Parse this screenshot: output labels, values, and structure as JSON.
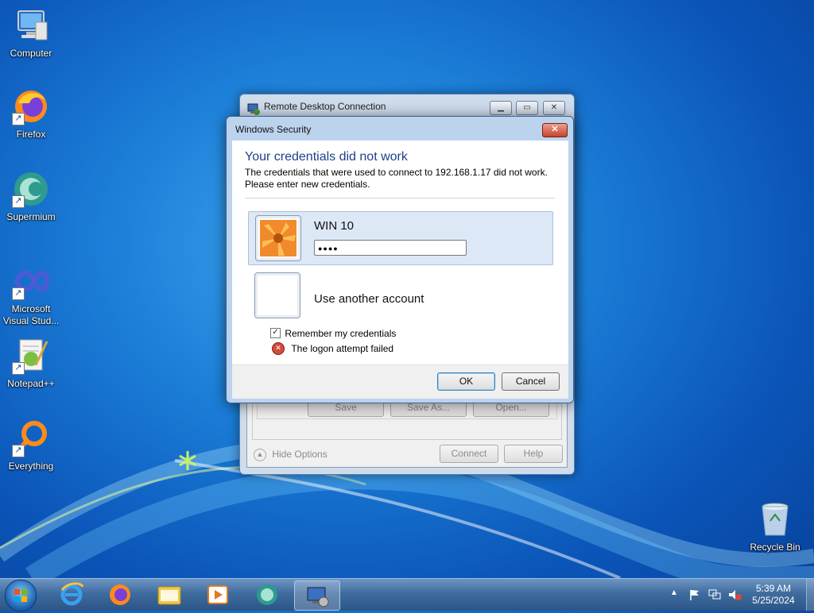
{
  "desktop": {
    "icons": [
      {
        "label": "Computer"
      },
      {
        "label": "Firefox"
      },
      {
        "label": "Supermium"
      },
      {
        "label_line1": "Microsoft",
        "label_line2": "Visual Stud..."
      },
      {
        "label": "Notepad++"
      },
      {
        "label": "Everything"
      },
      {
        "label": "Recycle Bin"
      }
    ]
  },
  "rdc_window": {
    "title": "Remote Desktop Connection",
    "buttons": {
      "save": "Save",
      "save_as": "Save As...",
      "open": "Open..."
    },
    "hide_options": "Hide Options",
    "connect": "Connect",
    "help": "Help"
  },
  "security_dialog": {
    "title": "Windows Security",
    "heading": "Your credentials did not work",
    "message_line1": "The credentials that were used to connect to 192.168.1.17 did not work.",
    "message_line2": "Please enter new credentials.",
    "account_name": "WIN 10",
    "password_masked": "●●●●",
    "other_account": "Use another account",
    "remember_label": "Remember my credentials",
    "remember_checked": true,
    "error_text": "The logon attempt failed",
    "ok": "OK",
    "cancel": "Cancel"
  },
  "taskbar": {
    "pinned": [
      "start-orb",
      "internet-explorer-icon",
      "firefox-icon",
      "file-explorer-icon",
      "media-player-icon",
      "supermium-icon",
      "remote-desktop-icon"
    ],
    "time": "5:39 AM",
    "date": "5/25/2024"
  },
  "colors": {
    "heading": "#1e3f8c",
    "accent": "#0b55b8",
    "selection": "#dce8f6"
  }
}
